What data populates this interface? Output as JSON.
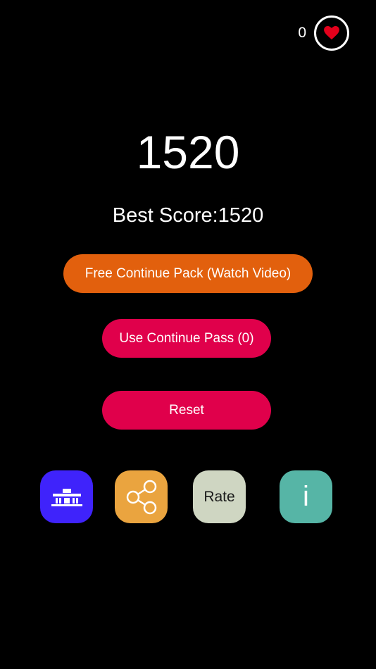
{
  "lives": {
    "count": "0",
    "icon": "heart-icon",
    "heart_color": "#e3001b"
  },
  "score": {
    "current": "1520",
    "best": "Best Score:1520"
  },
  "buttons": {
    "free_continue": "Free Continue Pack (Watch Video)",
    "use_pass": "Use Continue Pass (0)",
    "reset": "Reset"
  },
  "tiles": {
    "leaderboard_icon": "podium-icon",
    "share_icon": "share-icon",
    "rate_label": "Rate",
    "info_label": "i"
  },
  "colors": {
    "orange": "#e2600d",
    "crimson": "#e0004b",
    "leaderboard": "#3f23fb",
    "share": "#eaa43f",
    "rate": "#cfd6c2",
    "info": "#56b5a6"
  }
}
